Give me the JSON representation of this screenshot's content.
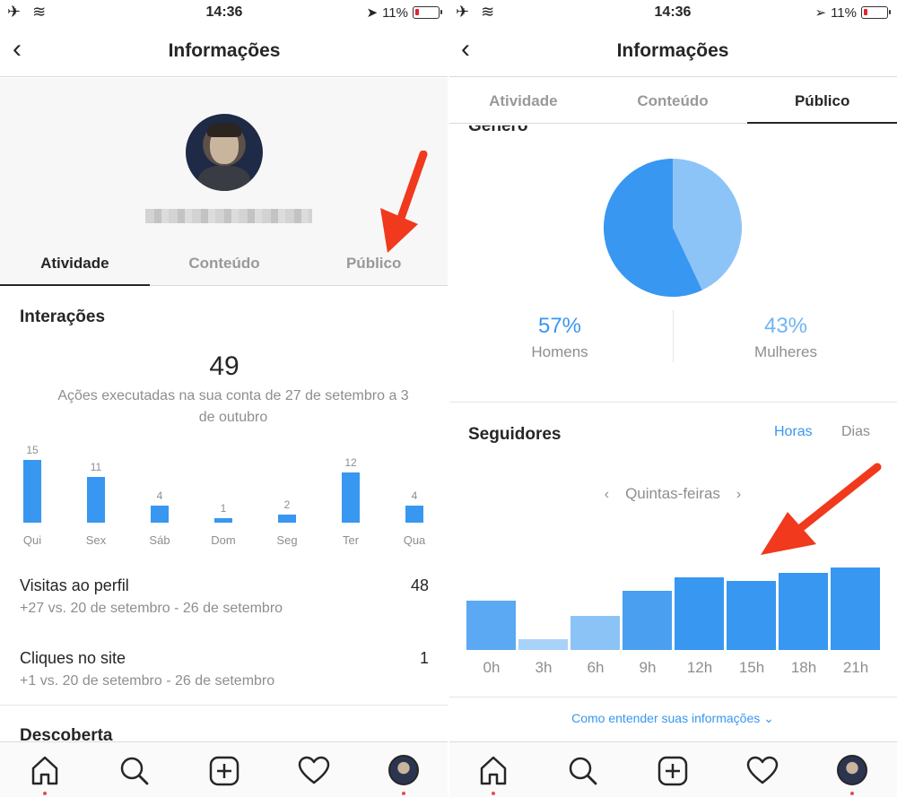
{
  "status_bar": {
    "time": "14:36",
    "battery": "11%"
  },
  "left": {
    "nav_title": "Informações",
    "tabs": [
      "Atividade",
      "Conteúdo",
      "Público"
    ],
    "interactions": {
      "title": "Interações",
      "total": "49",
      "description": "Ações executadas na sua conta de 27 de setembro a 3 de outubro"
    },
    "profile_visits": {
      "label": "Visitas ao perfil",
      "value": "48",
      "comparison": "+27 vs. 20 de setembro - 26 de setembro"
    },
    "site_clicks": {
      "label": "Cliques no site",
      "value": "1",
      "comparison": "+1 vs. 20 de setembro - 26 de setembro"
    },
    "discovery_title": "Descoberta"
  },
  "right": {
    "nav_title": "Informações",
    "tabs": [
      "Atividade",
      "Conteúdo",
      "Público"
    ],
    "gender": {
      "title": "Gênero",
      "men_pct": "57%",
      "men_label": "Homens",
      "women_pct": "43%",
      "women_label": "Mulheres"
    },
    "followers": {
      "title": "Seguidores",
      "toggle_hours": "Horas",
      "toggle_days": "Dias",
      "day": "Quintas-feiras"
    },
    "footer_link": "Como entender suas informações"
  },
  "chart_data": [
    {
      "type": "bar",
      "categories": [
        "Qui",
        "Sex",
        "Sáb",
        "Dom",
        "Seg",
        "Ter",
        "Qua"
      ],
      "values": [
        15,
        11,
        4,
        1,
        2,
        12,
        4
      ]
    },
    {
      "type": "pie",
      "categories": [
        "Homens",
        "Mulheres"
      ],
      "values": [
        57,
        43
      ]
    },
    {
      "type": "bar",
      "categories": [
        "0h",
        "3h",
        "6h",
        "9h",
        "12h",
        "15h",
        "18h",
        "21h"
      ],
      "values": [
        55,
        12,
        38,
        66,
        81,
        77,
        86,
        92
      ]
    }
  ],
  "colors": {
    "accent": "#3897f0",
    "pie_men": "#3897f0",
    "pie_women": "#8dc4f7",
    "arrow": "#f0391d"
  }
}
